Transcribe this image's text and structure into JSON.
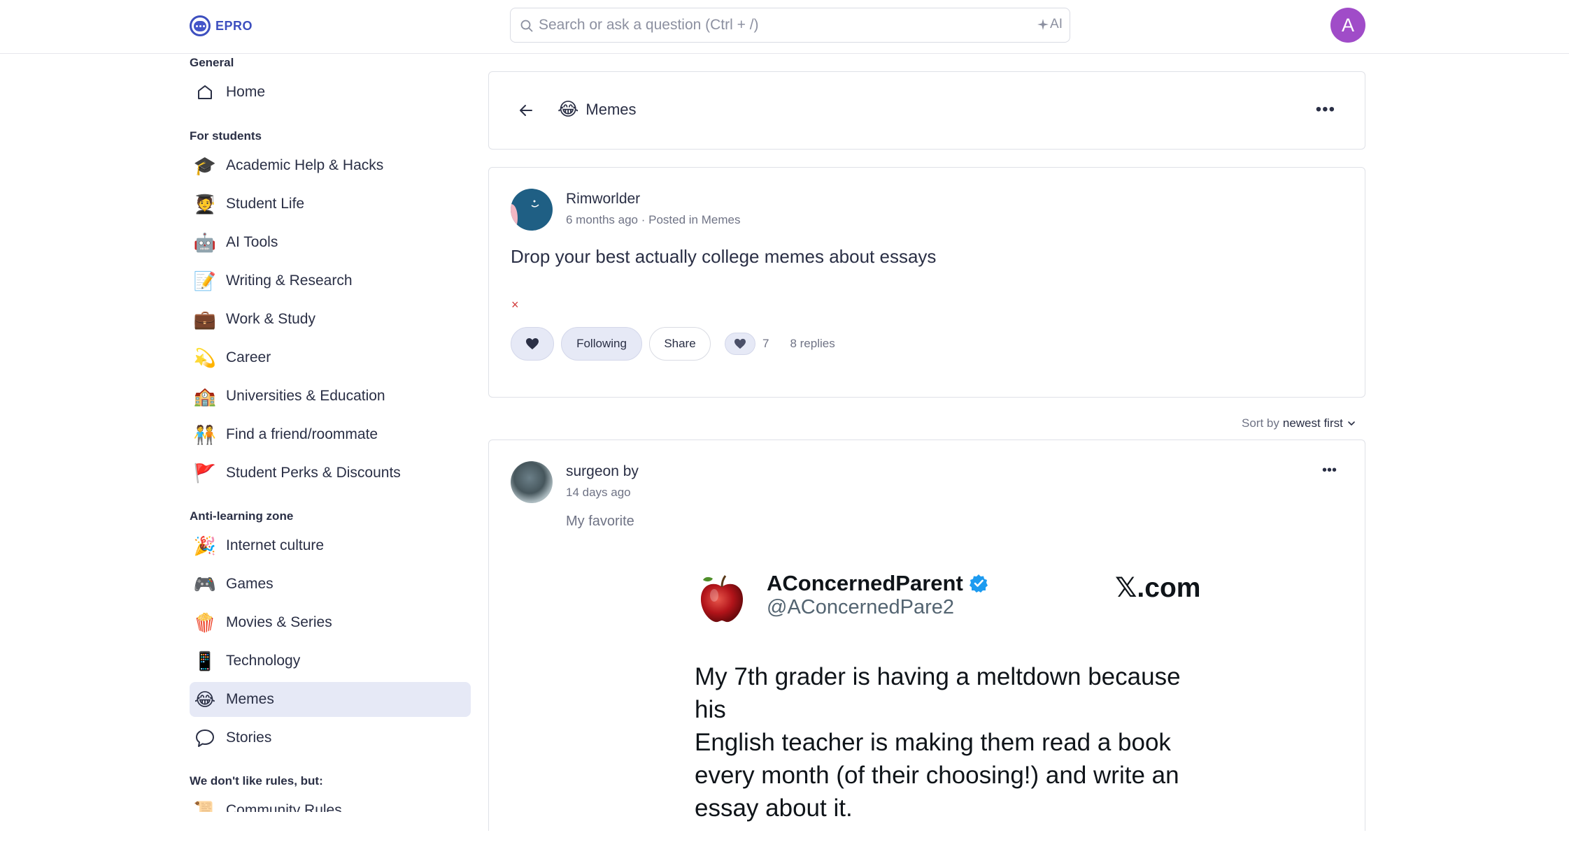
{
  "header": {
    "logo_text": "EPRO",
    "search_placeholder": "Search or ask a question (Ctrl + /)",
    "ai_label": "AI",
    "user_initial": "A"
  },
  "sidebar": {
    "sections": [
      {
        "title": "General",
        "items": [
          {
            "emoji": "",
            "icon": "home-icon",
            "label": "Home"
          }
        ]
      },
      {
        "title": "For students",
        "items": [
          {
            "emoji": "🎓",
            "label": "Academic Help & Hacks"
          },
          {
            "emoji": "🧑‍🎓",
            "label": "Student Life"
          },
          {
            "emoji": "🤖",
            "label": "AI Tools"
          },
          {
            "emoji": "📝",
            "label": "Writing & Research"
          },
          {
            "emoji": "💼",
            "label": "Work & Study"
          },
          {
            "emoji": "💫",
            "label": "Career"
          },
          {
            "emoji": "🏫",
            "label": "Universities & Education"
          },
          {
            "emoji": "🧑‍🤝‍🧑",
            "label": "Find a friend/roommate"
          },
          {
            "emoji": "🚩",
            "label": "Student Perks & Discounts"
          }
        ]
      },
      {
        "title": "Anti-learning zone",
        "items": [
          {
            "emoji": "🎉",
            "label": "Internet culture"
          },
          {
            "emoji": "🎮",
            "label": "Games"
          },
          {
            "emoji": "🍿",
            "label": "Movies & Series"
          },
          {
            "emoji": "📱",
            "label": "Technology"
          },
          {
            "emoji": "😂",
            "label": "Memes",
            "active": true
          },
          {
            "emoji": "",
            "icon": "speech-bubble-icon",
            "label": "Stories"
          }
        ]
      },
      {
        "title": "We don't like rules, but:",
        "items": [
          {
            "emoji": "📜",
            "label": "Community Rules"
          }
        ]
      }
    ]
  },
  "topic": {
    "emoji": "😂",
    "title": "Memes"
  },
  "post": {
    "author": "Rimworlder",
    "meta": "6 months ago · Posted in Memes",
    "title": "Drop your best actually college memes about essays",
    "broken_image": "×",
    "following_label": "Following",
    "share_label": "Share",
    "like_count": "7",
    "replies": "8 replies"
  },
  "sort": {
    "prefix": "Sort by",
    "value": "newest first"
  },
  "reply": {
    "author": "surgeon by",
    "meta": "14 days ago",
    "text": "My favorite",
    "tweet": {
      "name": "AConcernedParent",
      "handle": "@AConcernedPare2",
      "brand": "𝕏.com",
      "text_lines": [
        "My 7th grader is having a meltdown because his",
        "English teacher is making them read a book",
        "every month (of their choosing!) and write an",
        "essay about it."
      ]
    }
  },
  "colors": {
    "brand": "#3d4fbf",
    "avatar": "#a04cc8",
    "active_bg": "#e6e9f6",
    "broken": "#d23b3b"
  }
}
